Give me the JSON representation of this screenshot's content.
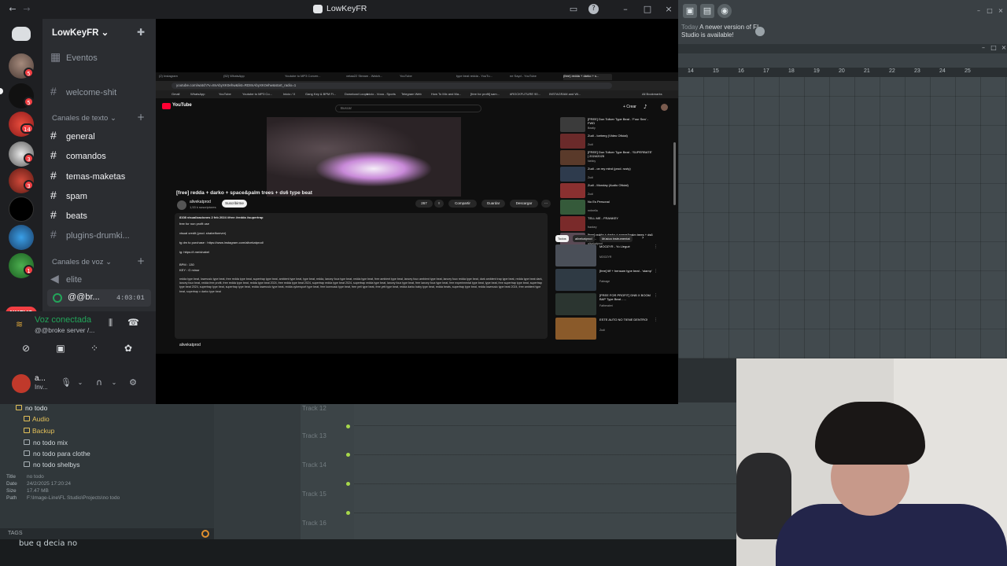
{
  "discord": {
    "window_title": "LowKeyFR",
    "guild_name": "LowKeyFR",
    "server_badges": [
      "5",
      "5",
      "14",
      "3",
      "3",
      "1"
    ],
    "nuevo_label": "NUEVO",
    "events_label": "Eventos",
    "welcome_channel": "welcome-shit",
    "text_category": "Canales de texto",
    "text_channels": [
      "general",
      "comandos",
      "temas-maketas",
      "spam",
      "beats",
      "plugins-drumki..."
    ],
    "voice_category": "Canales de voz",
    "voice_channels": [
      "elite",
      "@@br..."
    ],
    "voice_timer": "4:03:01",
    "voice_connected_label": "Voz conectada",
    "voice_connected_sub": "@@broke server /...",
    "user_name": "a...",
    "user_status": "Inv..."
  },
  "browser": {
    "tabs": [
      "(2) Instagram",
      "(52) WhatsApp",
      "Youtube to MP3 Conver...",
      "vetaa22 Stream - Watch...",
      "YouTube",
      "type beat redda - YouTu...",
      "ne Sayd - YouTube",
      "(free) redda + darko + s..."
    ],
    "url": "youtube.com/watch?v=8nAbyXK0ehw&list=RD8nAbyXK0ehw&start_radio=1",
    "bookmarks": [
      "Gmail",
      "WhatsApp",
      "YouTube",
      "Youtube to MP3 Co...",
      "Inicio / X",
      "Gang Key & BPM Fi...",
      "Download Loops",
      "Inicio - Voxa - Sports",
      "Telegram Web",
      "How To Mix and Ma...",
      "[free for profit] sam...",
      "#ROCKFUTURE 90...",
      "INSTAGRAM and Wi..."
    ],
    "all_bookmarks": "All Bookmarks"
  },
  "youtube": {
    "logo_text": "YouTube",
    "search_placeholder": "Buscar",
    "create_label": "+ Crear",
    "video_title": "[free] redda + darko + space&palm trees + ds6 type beat",
    "channel_name": "alivekatprod",
    "channel_subs": "1,53 k suscriptores",
    "subscribe_label": "Suscribirme",
    "like_count": "267",
    "share_label": "Compartir",
    "save_label": "Guardar",
    "download_label": "Descargar",
    "desc_views": "8108 visualizaciones  2 feb 2024  #free #redda #supertrap",
    "desc_lines": [
      "free for non profit use",
      "visual credit (prod. shabelforever)",
      "tg dm to purchase : https://www.instagram.com/alivekatprod/",
      "ig: https://t.me/shabel",
      "BPM : 130",
      "KEY : G minor"
    ],
    "desc_tags": "redda type beat, lowmusic type beat, free redda type beat, supertrap type beat, ambient type beat, type beat, redda, lancey foux type beat, redda type beat, free ambient type beat, lancey foux ambient type beat, lancey foux redda type beat, dark ambient trap type beat, redda type beat dark, lancey foux beat, redda free profit, free redda type beat, redda type beat 2024, free redda type beat 2024, supertrap redda type beat 2024, supertrap redda type beat, lancey foux type beat, free lancey foux type beat, free experimental type beat, type beat, free supertrap type beat, supertrap type beat 2024, supertrap type beat, supertrap type beat, redda lowmusic type beat, redda cybersport type beat, free lowmusic type beat, free yeti type beat, free yeti type beat, redda darko baby type beat, redda beats, supertrap type beat, redda lowmusic type beat 2024, free ambient type beat, supertrap x darko type beat",
    "comments_channel": "alivekatprod",
    "sidebar_videos": [
      {
        "title": "[FREE] Don Toliver Type Beat - 'Four Sea' - FWD",
        "channel": "Beatly"
      },
      {
        "title": "Zudi - Iceberg (Video Oficial)",
        "channel": "Zudi"
      },
      {
        "title": "[FREE] Don Toliver Type Beat - 'SUPERBATE' | 2024/2025",
        "channel": "Nebby"
      },
      {
        "title": "Zudi - on my mind (prod. rusty)",
        "channel": "Zudi"
      },
      {
        "title": "Zudi - Monday (Audio Oficial)",
        "channel": "Zudi"
      },
      {
        "title": "No Es Personal",
        "channel": "rmbrella"
      },
      {
        "title": "TELL ME - FRANKEY",
        "channel": "frankey"
      },
      {
        "title": "[free] redda + darko + space&palm trees + ds6 type...",
        "channel": "alivekatprod"
      }
    ],
    "chips": [
      "Todos",
      "alivekatprod",
      "Música instrumental"
    ],
    "sidebar_videos2": [
      {
        "title": "MOOZYR - Yo Llegué",
        "channel": "MOOZYR"
      },
      {
        "title": "[free] tiff + hensam type beat - 'stamp'",
        "channel": "Fabrage"
      },
      {
        "title": "[FREE FOR PROFIT] DNB X BOOM BAP Type Beat - ...",
        "channel": "Fatheraleri"
      },
      {
        "title": "ESTE AUTO NO TIENE DENTRO!",
        "channel": "Zudi"
      }
    ]
  },
  "flstudio": {
    "notification_date": "Today",
    "notification_text": "A newer version of FL Studio is available!",
    "ruler_bars": [
      "14",
      "15",
      "16",
      "17",
      "18",
      "19",
      "20",
      "21",
      "22",
      "23",
      "24",
      "25"
    ],
    "browser_root": "no todo",
    "browser_folders": [
      "Audio",
      "Backup"
    ],
    "browser_files": [
      "no todo mix",
      "no todo para clothe",
      "no todo shelbys"
    ],
    "info_labels": [
      "Title",
      "Date",
      "Size",
      "Path"
    ],
    "info_values": [
      "no todo",
      "24/2/2025 17:20:24",
      "17.47 MB",
      "F:\\Image-Line\\FL Studio\\Projects\\no todo"
    ],
    "tags_label": "TAGS",
    "tracks": [
      "Track 12",
      "Track 13",
      "Track 14",
      "Track 15",
      "Track 16"
    ],
    "subtitle": "bue q decia no"
  }
}
